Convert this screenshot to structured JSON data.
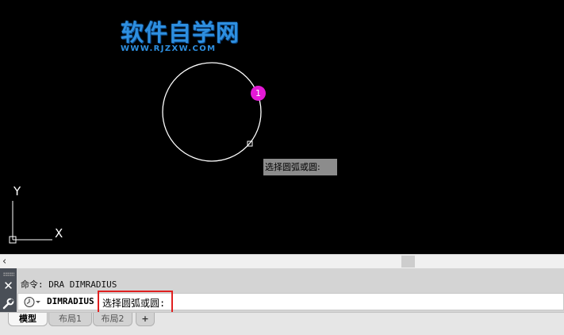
{
  "watermark": {
    "title": "软件自学网",
    "url": "WWW.RJZXW.COM"
  },
  "canvas": {
    "marker_label": "1",
    "tooltip": "选择圆弧或圆:",
    "ucs_axis_x": "X",
    "ucs_axis_y": "Y"
  },
  "scrollbar": {
    "left_arrow": "‹"
  },
  "command": {
    "close_glyph": "✕",
    "history": "命令: DRA DIMRADIUS",
    "current_command": "DIMRADIUS",
    "prompt": "选择圆弧或圆:"
  },
  "tabs": {
    "model": "模型",
    "layout1": "布局1",
    "layout2": "布局2",
    "add": "+"
  },
  "colors": {
    "canvas_bg": "#000000",
    "watermark": "#2e8fe0",
    "marker": "#e419d6",
    "highlight_box": "#e02020"
  }
}
